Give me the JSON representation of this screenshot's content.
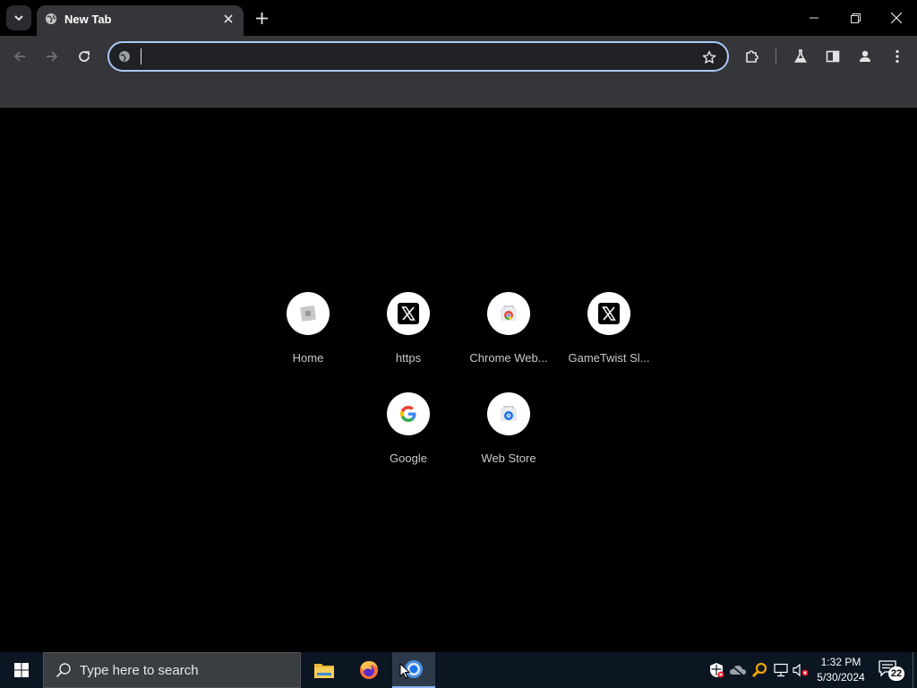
{
  "browser": {
    "tab": {
      "title": "New Tab"
    },
    "omnibox": {
      "value": "",
      "placeholder": ""
    }
  },
  "shortcuts": [
    {
      "label": "Home",
      "icon": "home-favicon-icon"
    },
    {
      "label": "https",
      "icon": "x-logo-icon"
    },
    {
      "label": "Chrome Web...",
      "icon": "chrome-webstore-icon"
    },
    {
      "label": "GameTwist Sl...",
      "icon": "x-logo-icon"
    },
    {
      "label": "Google",
      "icon": "google-g-icon"
    },
    {
      "label": "Web Store",
      "icon": "webstore-icon"
    }
  ],
  "taskbar": {
    "search_placeholder": "Type here to search",
    "apps": [
      "file-explorer-icon",
      "firefox-icon",
      "chrome-icon"
    ],
    "clock": {
      "time": "1:32 PM",
      "date": "5/30/2024"
    },
    "notifications_count": "22"
  },
  "colors": {
    "background": "#000000",
    "toolbar": "#35363a",
    "omnibox_focus": "#a8c7fa",
    "taskbar": "#0b1622"
  }
}
